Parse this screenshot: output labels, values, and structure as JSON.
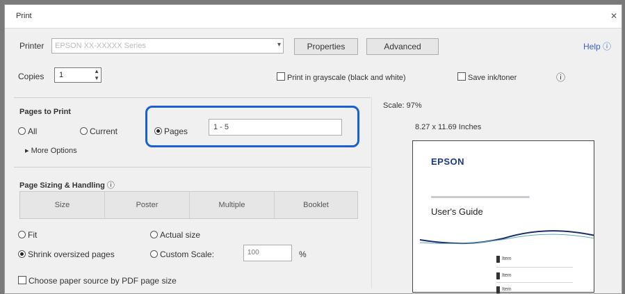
{
  "window": {
    "title": "Print",
    "close_glyph": "✕"
  },
  "printer": {
    "label": "Printer",
    "value": "EPSON XX-XXXXX Series",
    "properties_label": "Properties",
    "advanced_label": "Advanced",
    "help_label": "Help",
    "help_icon": "help-circle-icon"
  },
  "copies": {
    "label": "Copies",
    "value": "1"
  },
  "options": {
    "grayscale_label": "Print in grayscale (black and white)",
    "save_ink_label": "Save ink/toner",
    "grayscale_checked": false,
    "save_ink_checked": false,
    "info_icon": "info-icon"
  },
  "pages_to_print": {
    "title": "Pages to Print",
    "all_label": "All",
    "current_label": "Current",
    "pages_label": "Pages",
    "pages_value": "1 - 5",
    "more_options_label": "More Options",
    "selected": "pages"
  },
  "page_sizing": {
    "title": "Page Sizing & Handling",
    "tabs": [
      "Size",
      "Poster",
      "Multiple",
      "Booklet"
    ]
  },
  "sizing_options": {
    "fit_label": "Fit",
    "actual_size_label": "Actual size",
    "shrink_label": "Shrink oversized pages",
    "custom_scale_label": "Custom Scale:",
    "scale_value": "100",
    "percent": "%",
    "choose_source_label": "Choose paper source by PDF page size",
    "selected": "shrink"
  },
  "preview": {
    "scale_text": "Scale: 97%",
    "size_text": "8.27 x 11.69 Inches",
    "brand": "EPSON",
    "doc_title": "User's Guide",
    "toc_items": [
      "Item",
      "Item",
      "Item"
    ]
  },
  "colors": {
    "highlight": "#1a5fd6",
    "brand": "#1b3a8c"
  }
}
